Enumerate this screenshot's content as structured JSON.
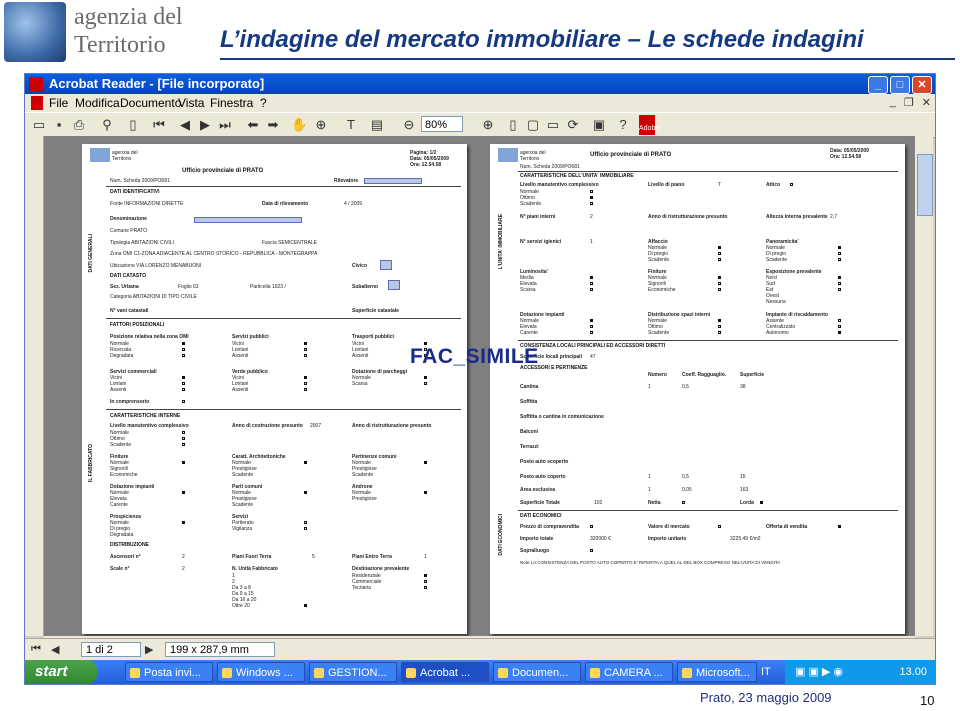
{
  "header": {
    "logo_line1": "agenzia del",
    "logo_line2": "Territorio",
    "title": "L’indagine del mercato immobiliare – Le schede indagini"
  },
  "window": {
    "title": "Acrobat Reader - [File incorporato]",
    "menu": [
      "File",
      "Modifica",
      "Documento",
      "Vista",
      "Finestra",
      "?"
    ],
    "zoom": "80%",
    "page_nav": "1 di 2",
    "page_size": "199 x 287,9 mm"
  },
  "document": {
    "page1": {
      "office": "Ufficio provinciale di PRATO",
      "pagina": "Pagina: 1/2",
      "data": "Data: 05/05/2009",
      "ora": "Ora: 12.54.58",
      "num_scheda": "Num. Scheda   2009/PO681",
      "rilevatore": "Rilevatore",
      "dati_identificativi": "DATI IDENTIFICATIVI",
      "fonte": "Fonte   INFORMAZIONI DIRETTE",
      "data_rilevamento": "Data di rilevamento",
      "data_rilevamento_val": "4 / 2009",
      "denominazione": "Denominazione",
      "comune": "Comune   PRATO",
      "tipologia": "Tipologia   ABITAZIONI CIVILI",
      "fascia": "Fascia   SEMICENTRALE",
      "zona_omi": "Zona OMI   C1-ZONA ADIACENTE AL CENTRO STORICO - REPUBBLICA - MONTEGRAPPA",
      "ubicazione": "Ubicazione   VIA LORENZO MENABUONI",
      "civico": "Civico",
      "dati_catasto": "DATI CATASTO",
      "sez_urbana": "Sez. Urbana",
      "foglio": "Foglio   63",
      "particella": "Particella   1923 /",
      "subalterno": "Subalterno",
      "categoria": "Categoria   ABITAZIONI DI TIPO CIVILE",
      "vani": "N° vani catastali",
      "superficie_catastale": "Superficie catastale",
      "side_generali": "DATI GENERALI",
      "fattori": "FATTORI POSIZIONALI",
      "posizione": "Posizione relativa nella zona OMI",
      "servizi_pubblici": "Servizi pubblici",
      "trasporti": "Trasporti pubblici",
      "opt_normale": "Normale",
      "opt_ricercata": "Ricercata",
      "opt_degradata": "Degradata",
      "opt_vicini": "Vicini",
      "opt_lontani": "Lontani",
      "opt_assenti": "Assenti",
      "servizi_comm": "Servizi commerciali",
      "verde": "Verde pubblico",
      "parcheggi": "Dotazione di parcheggi",
      "opt_scarsa": "Scarsa",
      "comprensorio": "In comprensorio",
      "caratt_interne": "CARATTERISTICHE INTERNE",
      "livello_man": "Livello manutentivo complessivo",
      "anno_costr": "Anno di costruzione presunto",
      "anno_costr_val": "2007",
      "anno_ristr": "Anno di ristrutturazione presunto",
      "opt_ottimo": "Ottimo",
      "opt_scadente": "Scadente",
      "finiture": "Finiture",
      "caratt_arch": "Caratt. Architettoniche",
      "pertinenze": "Pertinenze comuni",
      "opt_signorili": "Signorili",
      "opt_economiche": "Economiche",
      "opt_prestigiose": "Prestigiose",
      "dotazione_imp": "Dotazione impianti",
      "parti_comuni": "Parti comuni",
      "androne": "Androne",
      "opt_elevata": "Elevata",
      "opt_carente": "Carente",
      "prospicienza": "Prospicienza",
      "servizi": "Servizi",
      "opt_di_pregio": "Di pregio",
      "opt_portierato": "Portierato",
      "opt_vigilanza": "Vigilanza",
      "distribuzione": "DISTRIBUZIONE",
      "ascensori": "Ascensori n°",
      "ascensori_val": "2",
      "piani_fuori_terra": "Piani Fuori Terra",
      "piani_fuori_terra_val": "5",
      "piani_entro_terra": "Piani Entro Terra",
      "piani_entro_terra_val": "1",
      "scale": "Scale n°",
      "scale_val": "2",
      "n_unita": "N. Unità Fabbricato",
      "destinazione": "Destinazione prevalente",
      "unita_rows": [
        "1",
        "2",
        "Da 3 a 8",
        "Da 9 a 15",
        "Da 16 a 20",
        "Oltre 20"
      ],
      "dest_rows": [
        "Residenziale",
        "Commerciale",
        "Terziaria"
      ],
      "side_fabbricato": "IL FABBRICATO"
    },
    "page2": {
      "office": "Ufficio provinciale di PRATO",
      "data": "Data: 05/05/2009",
      "ora": "Ora: 12.54.58",
      "num_scheda": "Num. Scheda   2009/PO681",
      "caratt_unita": "CARATTERISTICHE DELL'UNITA' IMMOBILIARE",
      "livello_man": "Livello manutentivo complessivo",
      "livello_piano": "Livello di piano",
      "livello_piano_val": "T",
      "attico": "Attico",
      "opt_normale": "Normale",
      "opt_ottimo": "Ottimo",
      "opt_scadente": "Scadente",
      "piani_interni": "N° piani interni",
      "piani_interni_val": "2",
      "anno_ristr": "Anno di ristrutturazione presunto",
      "altezza": "Altezza interna prevalente",
      "altezza_val": "2,7",
      "servizi_igienici": "N° servizi igienici",
      "servizi_igienici_val": "1",
      "affaccio": "Affaccio",
      "panoramicita": "Panoramicita'",
      "opt_di_pregio": "Di pregio",
      "luminosita": "Luminosita'",
      "finiture": "Finiture",
      "esposizione": "Esposizione prevalente",
      "opt_media": "Media",
      "opt_elevata": "Elevata",
      "opt_scarsa": "Scarsa",
      "opt_signorili": "Signorili",
      "opt_economiche": "Economiche",
      "opt_nord": "Nord",
      "opt_sud": "Sud",
      "opt_est": "Est",
      "opt_ovest": "Ovest",
      "opt_nessuna": "Nessuna",
      "dotazione_imp": "Dotazione impianti",
      "distribuzione_spazi": "Distribuzione spazi interni",
      "impianto_risc": "Impianto di riscaldamento",
      "opt_carente": "Carente",
      "opt_assente": "Assente",
      "opt_centralizzato": "Centralizzato",
      "opt_autonomo": "Autonomo",
      "side_unita": "L'UNITA' IMMOBILIARE",
      "consistenza": "CONSISTENZA LOCALI PRINCIPALI ED ACCESSORI DIRETTI",
      "sup_principale": "Superficie locali principali",
      "sup_principale_val": "47",
      "pertinenze_hdr": "ACCESSORI E PERTINENZE",
      "numero": "Numero",
      "coeff": "Coeff. Ragguaglio.",
      "superficie": "Superficie",
      "rows": [
        {
          "label": "Cantina",
          "numero": "1",
          "coeff": "0,5",
          "sup": "38"
        },
        {
          "label": "Soffitta",
          "numero": "",
          "coeff": "",
          "sup": ""
        },
        {
          "label": "Soffitta o cantina in comunicazione",
          "numero": "",
          "coeff": "",
          "sup": ""
        },
        {
          "label": "Balconi",
          "numero": "",
          "coeff": "",
          "sup": ""
        },
        {
          "label": "Terrazzi",
          "numero": "",
          "coeff": "",
          "sup": ""
        },
        {
          "label": "Posto auto scoperto",
          "numero": "",
          "coeff": "",
          "sup": ""
        },
        {
          "label": "Posto auto coperto",
          "numero": "1",
          "coeff": "0,5",
          "sup": "15"
        },
        {
          "label": "Area esclusiva",
          "numero": "1",
          "coeff": "0,05",
          "sup": "163"
        }
      ],
      "sup_totale": "Superficie Totale",
      "sup_totale_val": "102",
      "netta": "Netta",
      "lorda": "Lorda",
      "dati_economici": "DATI ECONOMICI",
      "prezzo": "Prezzo di compravendita",
      "valore_mercato": "Valore di mercato",
      "offerta": "Offerta di vendita",
      "importo_totale": "Importo totale",
      "importo_totale_val": "320000 €",
      "importo_unitario": "Importo unitario",
      "importo_unitario_val": "3225,49 €/m2",
      "sopralluogo": "Sopralluogo",
      "note": "Note   LA CONSISTENZA DEL POSTO AUTO COPERTO E' RIFERITA A QUEL AL DEL BOX COMPRESO NEL'UNITA DI VENDITA",
      "side_economici": "DATI ECONOMICI"
    }
  },
  "watermark": "FAC_SIMILE",
  "taskbar": {
    "start": "start",
    "tasks": [
      "Posta invi...",
      "Windows ...",
      "GESTION...",
      "Acrobat ...",
      "Documen...",
      "CAMERA ...",
      "Microsoft..."
    ],
    "lang": "IT",
    "clock": "13.00"
  },
  "footer": {
    "date": "Prato, 23 maggio 2009",
    "page_number": "10"
  },
  "colors": {
    "title": "#163a80",
    "titlebar": "#0a5fe0",
    "taskbar": "#245edc",
    "start": "#2f8b2f"
  }
}
